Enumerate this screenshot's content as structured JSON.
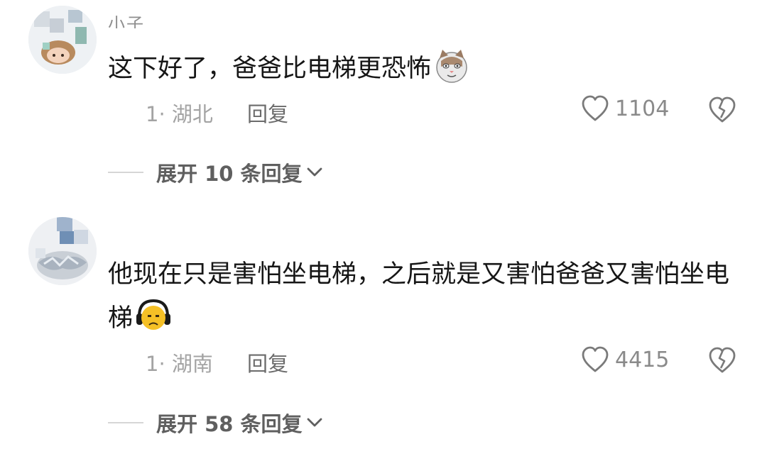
{
  "comments": [
    {
      "username": "小子",
      "text": "这下好了，爸爸比电梯更恐怖",
      "emoji": "cat-face-icon",
      "meta": "1· 湖北",
      "reply_label": "回复",
      "like_count": "1104",
      "expand_label": "展开 10 条回复"
    },
    {
      "username": "",
      "text": "他现在只是害怕坐电梯，之后就是又害怕爸爸又害怕坐电梯",
      "emoji": "headphones-face-icon",
      "meta": "1· 湖南",
      "reply_label": "回复",
      "like_count": "4415",
      "expand_label": "展开 58 条回复"
    }
  ],
  "colors": {
    "text": "#161616",
    "muted": "#a3a3a3",
    "reply": "#6b6b6b",
    "expand": "#5f5f5f"
  }
}
